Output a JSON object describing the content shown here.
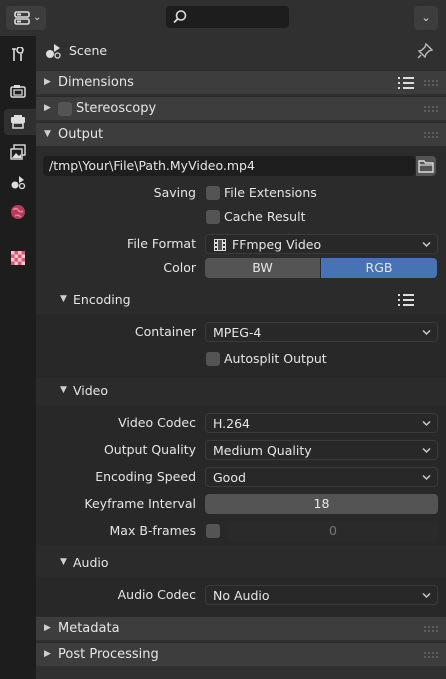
{
  "header": {
    "editor_icon": "properties-editor-icon",
    "search_icon": "search-icon",
    "search_value": ""
  },
  "tabs": [
    {
      "name": "tool",
      "icon": "wrench-screwdriver-icon"
    },
    {
      "name": "render",
      "icon": "camera-back-icon"
    },
    {
      "name": "output",
      "icon": "printer-icon",
      "active": true
    },
    {
      "name": "view-layer",
      "icon": "image-stack-icon"
    },
    {
      "name": "scene",
      "icon": "scene-icon"
    },
    {
      "name": "world",
      "icon": "world-icon"
    },
    {
      "name": "texture",
      "icon": "checker-texture-icon"
    }
  ],
  "context": {
    "label": "Scene"
  },
  "panels": {
    "dimensions": "Dimensions",
    "stereoscopy": "Stereoscopy",
    "output": "Output",
    "metadata": "Metadata",
    "post_processing": "Post Processing"
  },
  "output": {
    "path": "/tmp\\Your\\File\\Path.MyVideo.mp4",
    "saving_label": "Saving",
    "file_extensions": "File Extensions",
    "cache_result": "Cache Result",
    "file_format_label": "File Format",
    "file_format": "FFmpeg Video",
    "color_label": "Color",
    "color_bw": "BW",
    "color_rgb": "RGB"
  },
  "encoding": {
    "title": "Encoding",
    "container_label": "Container",
    "container": "MPEG-4",
    "autosplit": "Autosplit Output"
  },
  "video": {
    "title": "Video",
    "codec_label": "Video Codec",
    "codec": "H.264",
    "quality_label": "Output Quality",
    "quality": "Medium Quality",
    "speed_label": "Encoding Speed",
    "speed": "Good",
    "keyframe_label": "Keyframe Interval",
    "keyframe": "18",
    "bframes_label": "Max B-frames",
    "bframes": "0"
  },
  "audio": {
    "title": "Audio",
    "codec_label": "Audio Codec",
    "codec": "No Audio"
  },
  "colors": {
    "accent": "#4772b3",
    "bg": "#303030",
    "panel_header": "#3d3d3d",
    "sub_bg": "#2b2b2b",
    "field": "#1e1e1e"
  }
}
